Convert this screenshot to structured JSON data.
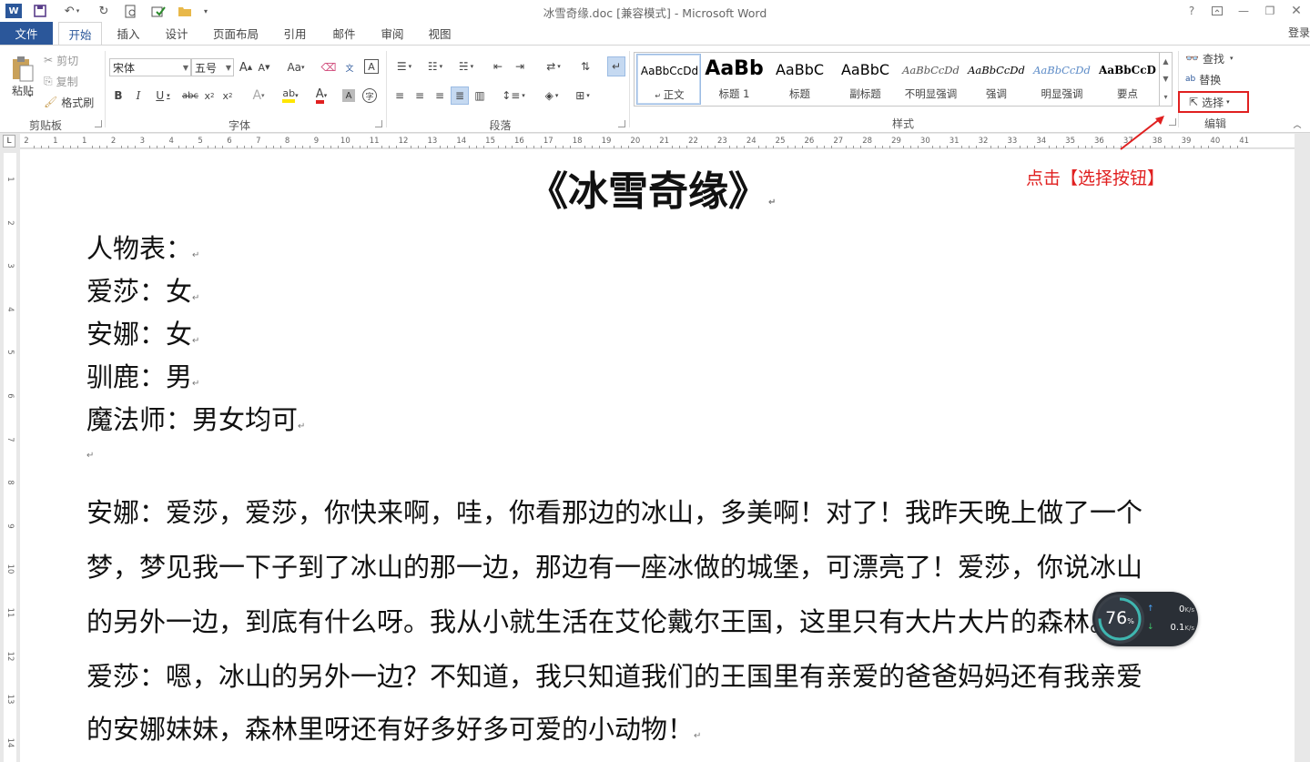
{
  "titlebar": {
    "logo_letter": "W",
    "title": "冰雪奇缘.doc [兼容模式] - Microsoft Word",
    "help": "?"
  },
  "tabs": {
    "file": "文件",
    "items": [
      "开始",
      "插入",
      "设计",
      "页面布局",
      "引用",
      "邮件",
      "审阅",
      "视图"
    ],
    "login": "登录"
  },
  "clipboard": {
    "paste": "粘贴",
    "cut": "剪切",
    "copy": "复制",
    "format_painter": "格式刷",
    "label": "剪贴板"
  },
  "font": {
    "family": "宋体",
    "size": "五号",
    "case_btn": "Aa",
    "label": "字体"
  },
  "paragraph": {
    "label": "段落"
  },
  "styles": {
    "label": "样式",
    "items": [
      {
        "preview": "AaBbCcDd",
        "name": "正文"
      },
      {
        "preview": "AaBb",
        "name": "标题 1"
      },
      {
        "preview": "AaBbC",
        "name": "标题"
      },
      {
        "preview": "AaBbC",
        "name": "副标题"
      },
      {
        "preview": "AaBbCcDd",
        "name": "不明显强调"
      },
      {
        "preview": "AaBbCcDd",
        "name": "强调"
      },
      {
        "preview": "AaBbCcDd",
        "name": "明显强调"
      },
      {
        "preview": "AaBbCcD",
        "name": "要点"
      }
    ]
  },
  "editing": {
    "find": "查找",
    "replace": "替换",
    "select": "选择",
    "label": "编辑"
  },
  "ruler_numbers": [
    "2",
    "1",
    "1",
    "2",
    "3",
    "4",
    "5",
    "6",
    "7",
    "8",
    "9",
    "10",
    "11",
    "12",
    "13",
    "14",
    "15",
    "16",
    "17",
    "18",
    "19",
    "20",
    "21",
    "22",
    "23",
    "24",
    "25",
    "26",
    "27",
    "28",
    "29",
    "30",
    "31",
    "32",
    "33",
    "34",
    "35",
    "36",
    "37",
    "38",
    "39",
    "40",
    "41"
  ],
  "vruler_numbers": [
    "1",
    "2",
    "3",
    "4",
    "5",
    "6",
    "7",
    "8",
    "9",
    "10",
    "11",
    "12",
    "13",
    "14"
  ],
  "document": {
    "title": "《冰雪奇缘》",
    "lines": [
      "人物表：",
      "爱莎：女",
      "安娜：女",
      "驯鹿：男",
      "魔法师：男女均可",
      "",
      "安娜：爱莎，爱莎，你快来啊，哇，你看那边的冰山，多美啊！对了！我昨天晚上做了一个",
      "梦，梦见我一下子到了冰山的那一边，那边有一座冰做的城堡，可漂亮了！爱莎，你说冰山",
      "的另外一边，到底有什么呀。我从小就生活在艾伦戴尔王国，这里只有大片大片的森林。",
      "爱莎：嗯，冰山的另外一边？不知道，我只知道我们的王国里有亲爱的爸爸妈妈还有我亲爱",
      "的安娜妹妹，森林里呀还有好多好多可爱的小动物！"
    ],
    "para_mark": "↵"
  },
  "annotation": {
    "text": "点击【选择按钮】",
    "color": "#e02020"
  },
  "speed_widget": {
    "percent": "76",
    "percent_suffix": "%",
    "upload": "0",
    "upload_unit": "K/s",
    "download": "0.1",
    "download_unit": "K/s"
  },
  "colors": {
    "accent": "#2b579a",
    "highlight": "#e02020"
  }
}
